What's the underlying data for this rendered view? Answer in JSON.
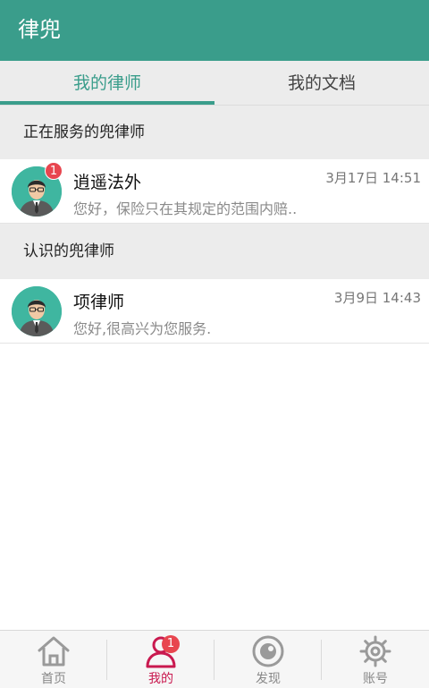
{
  "app": {
    "title": "律兜"
  },
  "tabs": [
    {
      "label": "我的律师",
      "active": true
    },
    {
      "label": "我的文档",
      "active": false
    }
  ],
  "sections": [
    {
      "header": "正在服务的兜律师",
      "items": [
        {
          "name": "逍遥法外",
          "message": "您好，保险只在其规定的范围内赔..",
          "time": "3月17日 14:51",
          "badge": "1",
          "avatar": "lawyer-avatar"
        }
      ]
    },
    {
      "header": "认识的兜律师",
      "items": [
        {
          "name": "项律师",
          "message": "您好,很高兴为您服务.",
          "time": "3月9日 14:43",
          "avatar": "lawyer-avatar"
        }
      ]
    }
  ],
  "bottom_nav": [
    {
      "label": "首页",
      "icon": "home-icon",
      "active": false
    },
    {
      "label": "我的",
      "icon": "user-icon",
      "active": true,
      "badge": "1"
    },
    {
      "label": "发现",
      "icon": "eye-icon",
      "active": false
    },
    {
      "label": "账号",
      "icon": "gear-icon",
      "active": false
    }
  ],
  "colors": {
    "primary": "#3a9d8b",
    "accent": "#c9194f",
    "badge": "#e8464f"
  }
}
